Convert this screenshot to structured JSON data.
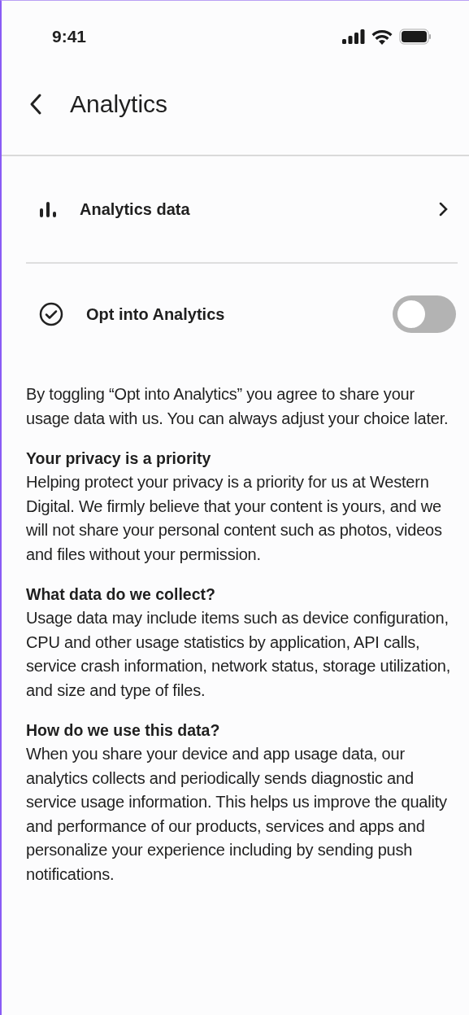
{
  "status_bar": {
    "time": "9:41"
  },
  "header": {
    "title": "Analytics"
  },
  "rows": [
    {
      "kind": "link",
      "label": "Analytics data"
    },
    {
      "kind": "toggle",
      "label": "Opt into Analytics",
      "on": false
    }
  ],
  "intro": "By toggling “Opt into Analytics” you agree to share your usage data with us. You can always adjust your choice later.",
  "sections": [
    {
      "heading": "Your privacy is a priority",
      "body": "Helping protect your privacy is a priority for us at Western Digital. We firmly believe that your content is yours, and we will not share your personal content such as photos, videos and files without your permission."
    },
    {
      "heading": "What data do we collect?",
      "body": "Usage data may include items such as device configuration, CPU and other usage statistics by application, API calls, service crash information, network status, storage utilization, and size and type of files."
    },
    {
      "heading": "How do we use this data?",
      "body": "When you share your device and app usage data, our analytics collects and periodically sends diagnostic and service usage information. This helps us improve the quality and performance of our products, services and apps and personalize your experience including by sending push notifications."
    }
  ]
}
